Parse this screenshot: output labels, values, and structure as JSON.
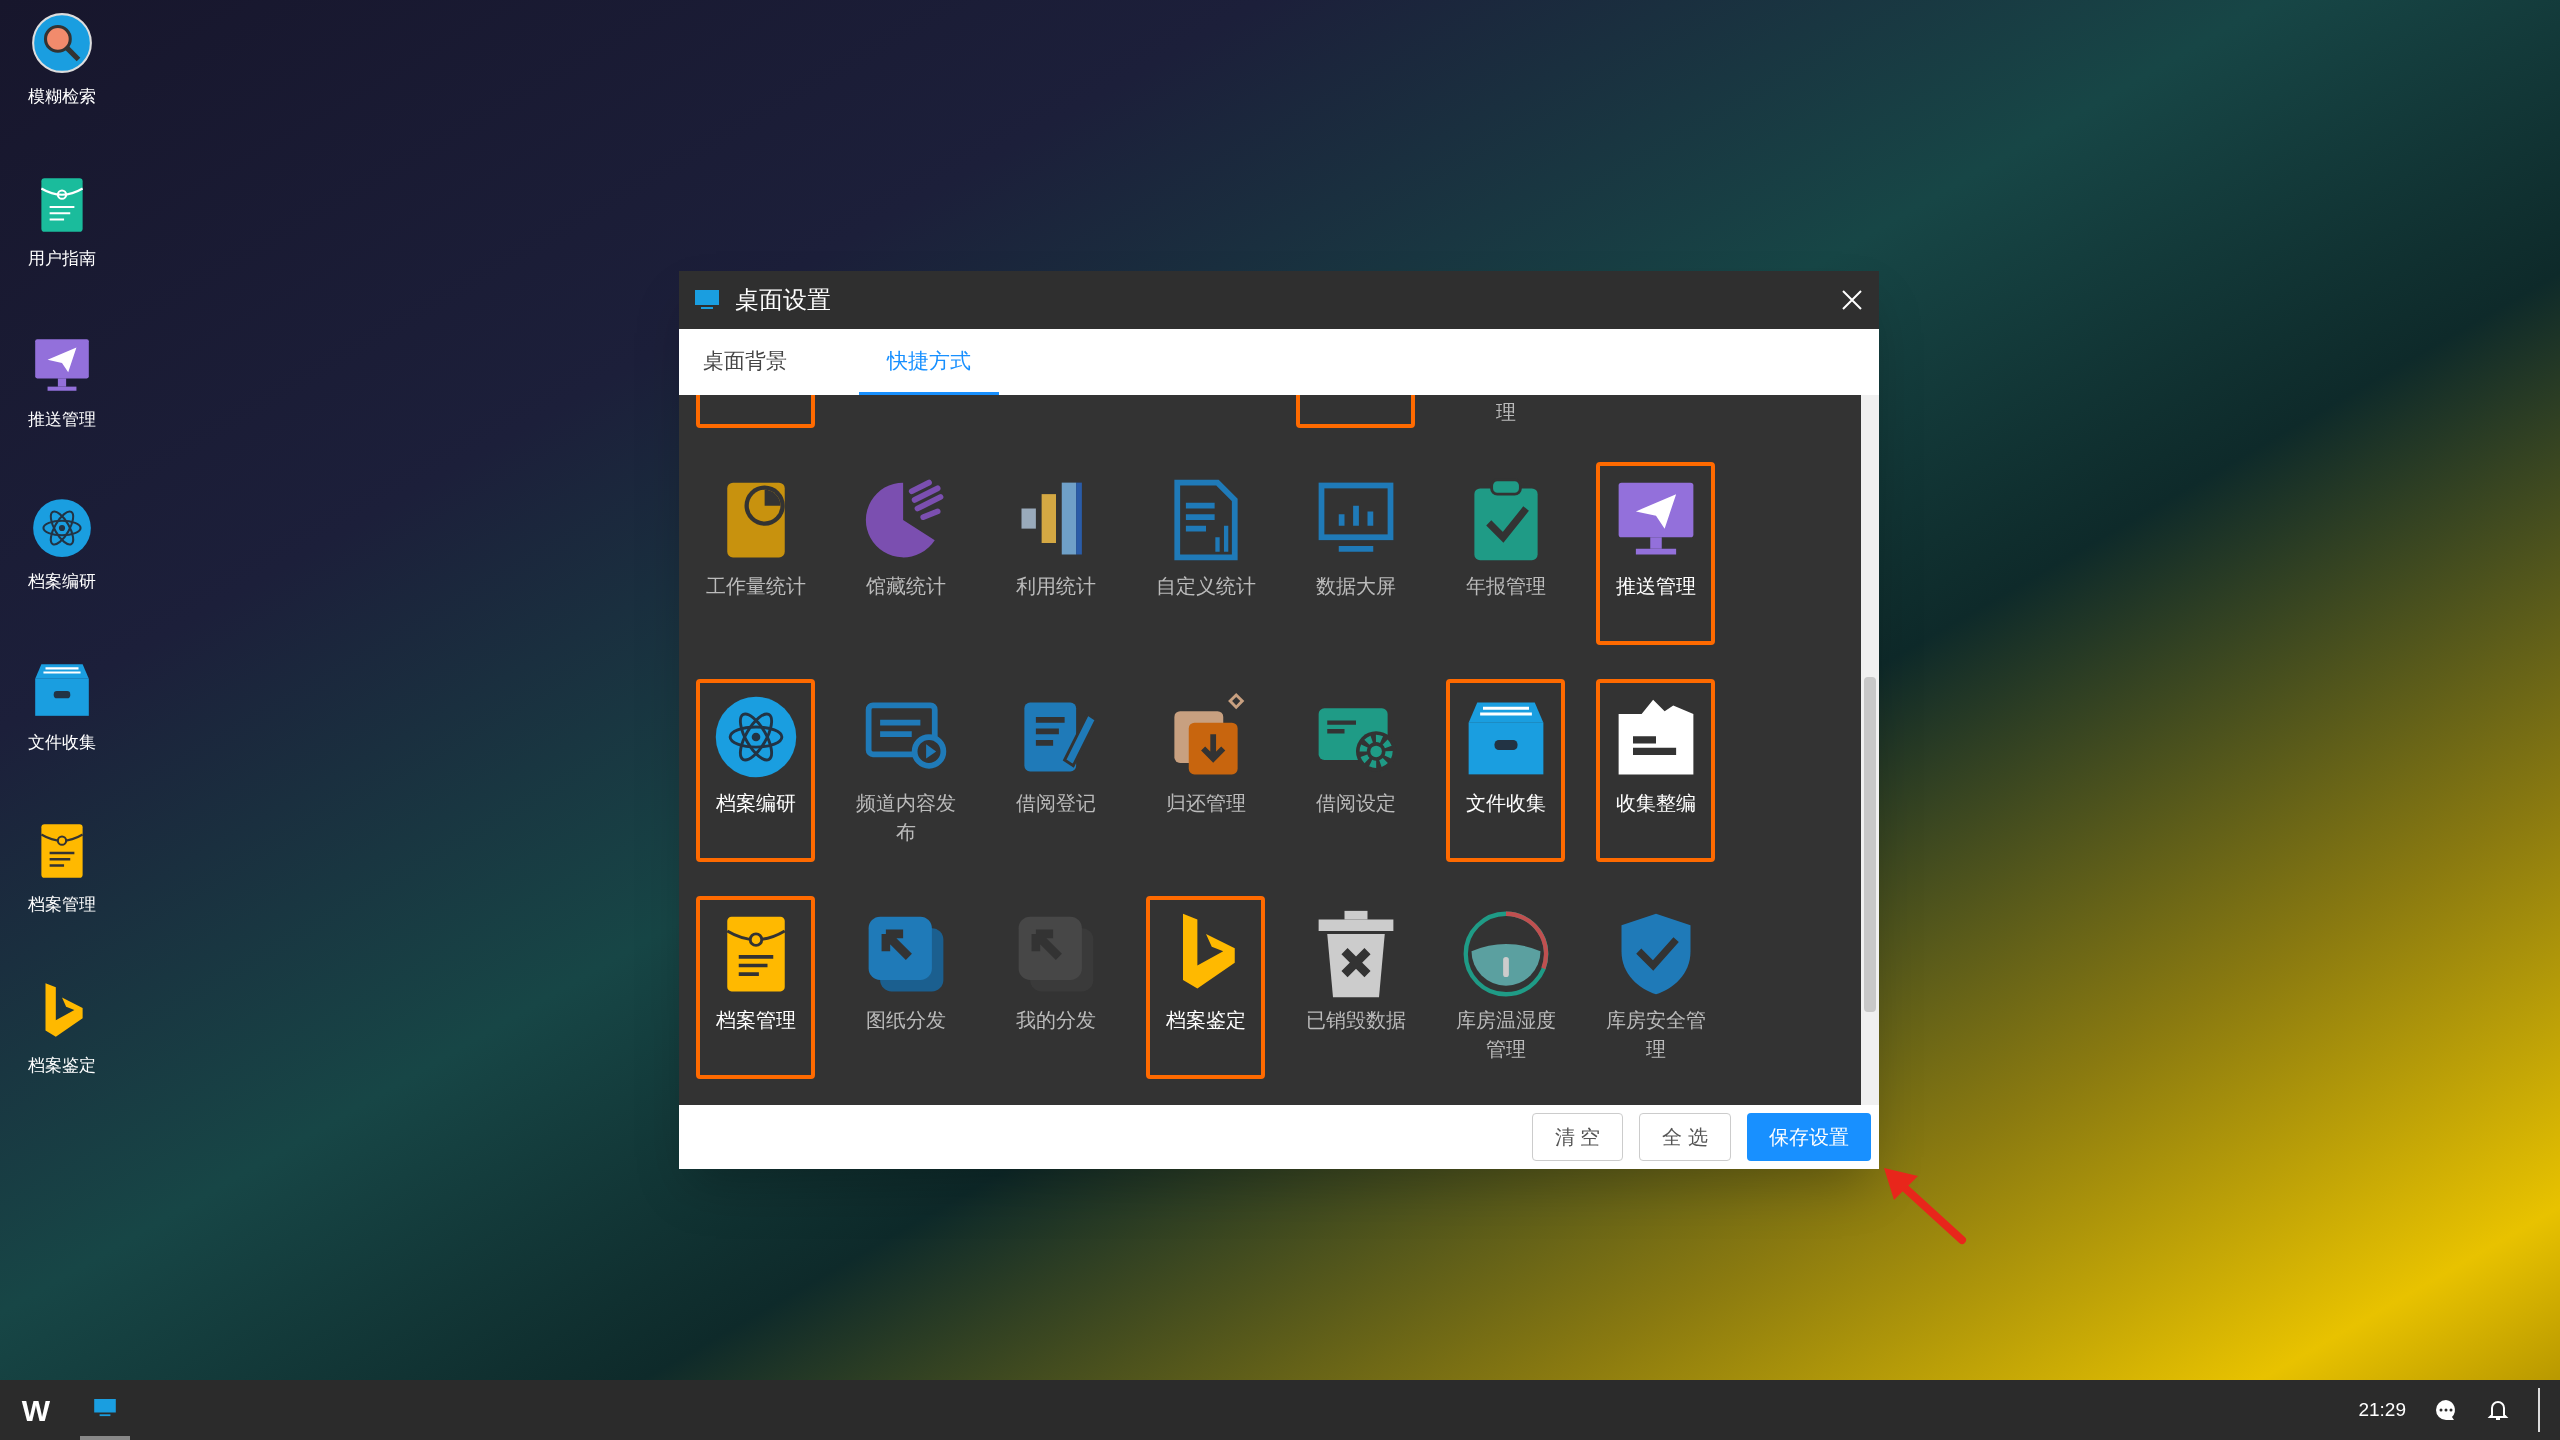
{
  "desktop_icons": [
    {
      "label": "模糊检索",
      "kind": "search"
    },
    {
      "label": "用户指南",
      "kind": "guide"
    },
    {
      "label": "推送管理",
      "kind": "push"
    },
    {
      "label": "档案编研",
      "kind": "research"
    },
    {
      "label": "文件收集",
      "kind": "collect"
    },
    {
      "label": "档案管理",
      "kind": "archive"
    },
    {
      "label": "档案鉴定",
      "kind": "appraise"
    }
  ],
  "dialog": {
    "title": "桌面设置",
    "tabs": [
      {
        "label": "桌面背景",
        "selected": false
      },
      {
        "label": "快捷方式",
        "selected": true
      }
    ],
    "shortcut_rows": [
      [
        {
          "selected": true
        },
        {
          "selected": false
        },
        {
          "selected": false
        },
        {
          "selected": false
        },
        {
          "selected": true
        },
        {
          "selected": false,
          "label": "理"
        },
        {
          "selected": false
        }
      ],
      [
        {
          "label": "工作量统计",
          "kind": "workload",
          "selected": false
        },
        {
          "label": "馆藏统计",
          "kind": "pie",
          "selected": false
        },
        {
          "label": "利用统计",
          "kind": "bars3d",
          "selected": false
        },
        {
          "label": "自定义统计",
          "kind": "report",
          "selected": false
        },
        {
          "label": "数据大屏",
          "kind": "screen",
          "selected": false
        },
        {
          "label": "年报管理",
          "kind": "clipboard",
          "selected": false
        },
        {
          "label": "推送管理",
          "kind": "push",
          "selected": true
        }
      ],
      [
        {
          "label": "档案编研",
          "kind": "research",
          "selected": true
        },
        {
          "label": "频道内容发布",
          "kind": "channel",
          "selected": false
        },
        {
          "label": "借阅登记",
          "kind": "notebook",
          "selected": false
        },
        {
          "label": "归还管理",
          "kind": "return",
          "selected": false
        },
        {
          "label": "借阅设定",
          "kind": "cardgear",
          "selected": false
        },
        {
          "label": "文件收集",
          "kind": "collect",
          "selected": true
        },
        {
          "label": "收集整编",
          "kind": "organize",
          "selected": true
        }
      ],
      [
        {
          "label": "档案管理",
          "kind": "archive",
          "selected": true
        },
        {
          "label": "图纸分发",
          "kind": "dist",
          "selected": false
        },
        {
          "label": "我的分发",
          "kind": "mydist",
          "selected": false
        },
        {
          "label": "档案鉴定",
          "kind": "appraise",
          "selected": true
        },
        {
          "label": "已销毁数据",
          "kind": "trash",
          "selected": false
        },
        {
          "label": "库房温湿度管理",
          "kind": "gauge",
          "selected": false
        },
        {
          "label": "库房安全管理",
          "kind": "shield",
          "selected": false
        }
      ]
    ],
    "buttons": [
      {
        "label": "清 空",
        "kind": "plain"
      },
      {
        "label": "全 选",
        "kind": "plain"
      },
      {
        "label": "保存设置",
        "kind": "primary"
      }
    ]
  },
  "taskbar": {
    "logo": "W",
    "clock": "21:29"
  }
}
